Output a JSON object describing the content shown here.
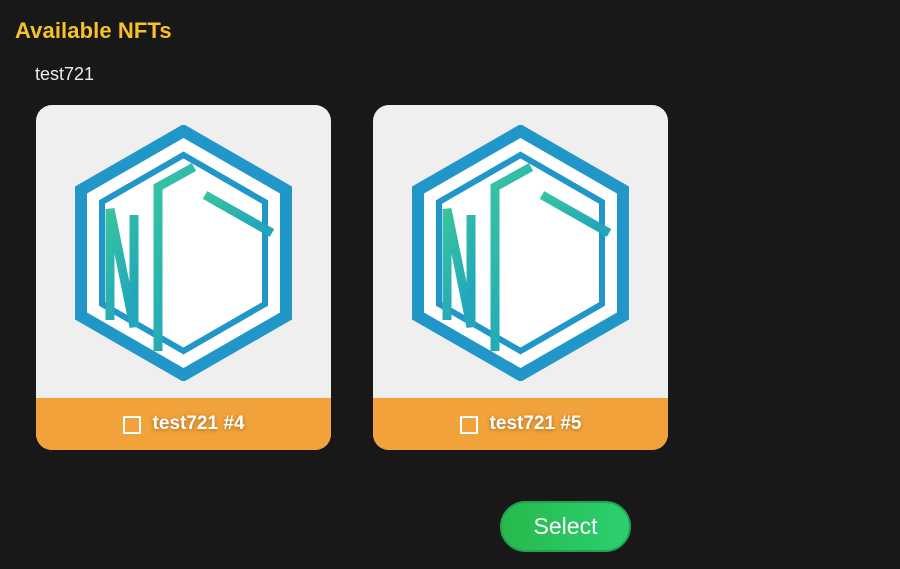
{
  "header": {
    "title": "Available NFTs"
  },
  "collection": {
    "name": "test721"
  },
  "cards": [
    {
      "label": "test721 #4",
      "checked": false,
      "image_icon": "nft-hexagon-logo-icon"
    },
    {
      "label": "test721 #5",
      "checked": false,
      "image_icon": "nft-hexagon-logo-icon"
    }
  ],
  "actions": {
    "select_label": "Select"
  },
  "colors": {
    "background": "#181818",
    "title": "#f6c12a",
    "card_footer": "#f2a23a",
    "button_green": "#27ba4b",
    "logo_blue": "#2196c9",
    "logo_teal": "#38c4a0"
  }
}
